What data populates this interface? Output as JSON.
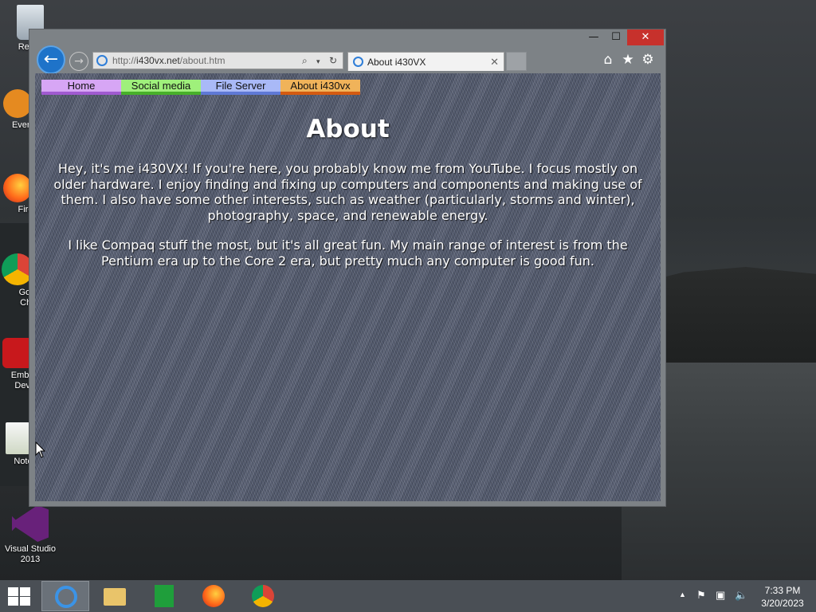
{
  "desktop": {
    "icons": [
      {
        "label": "Recyc"
      },
      {
        "label": "Every"
      },
      {
        "label": "Fire"
      },
      {
        "label": "Goo\nChr"
      },
      {
        "label": "Embar\nDev-"
      },
      {
        "label": "Note"
      },
      {
        "label": "Visual Studio\n2013"
      }
    ]
  },
  "browser": {
    "address": {
      "url_prefix": "http://",
      "url_host": "i430vx.net",
      "url_path": "/about.htm"
    },
    "tab": {
      "title": "About i430VX",
      "close": "✕"
    },
    "window_controls": {
      "minimize": "—",
      "maximize": "☐",
      "close": "✕"
    }
  },
  "page": {
    "nav": [
      {
        "label": "Home",
        "color": "#d7a6f5"
      },
      {
        "label": "Social media",
        "color": "#9ff07b"
      },
      {
        "label": "File Server",
        "color": "#a9b9f7"
      },
      {
        "label": "About i430vx",
        "color": "#f0b35a"
      }
    ],
    "heading": "About",
    "paragraph1": "Hey, it's me i430VX! If you're here, you probably know me from YouTube. I focus mostly on older hardware. I enjoy finding and fixing up computers and components and making use of them. I also have some other interests, such as weather (particularly, storms and winter), photography, space, and renewable energy.",
    "paragraph2": "I like Compaq stuff the most, but it's all great fun. My main range of interest is from the Pentium era up to the Core 2 era, but pretty much any computer is good fun."
  },
  "taskbar": {
    "apps": [
      "ie-icon",
      "file-explorer-icon",
      "store-icon",
      "firefox-icon",
      "chrome-icon"
    ],
    "clock": {
      "time": "7:33 PM",
      "date": "3/20/2023"
    }
  }
}
